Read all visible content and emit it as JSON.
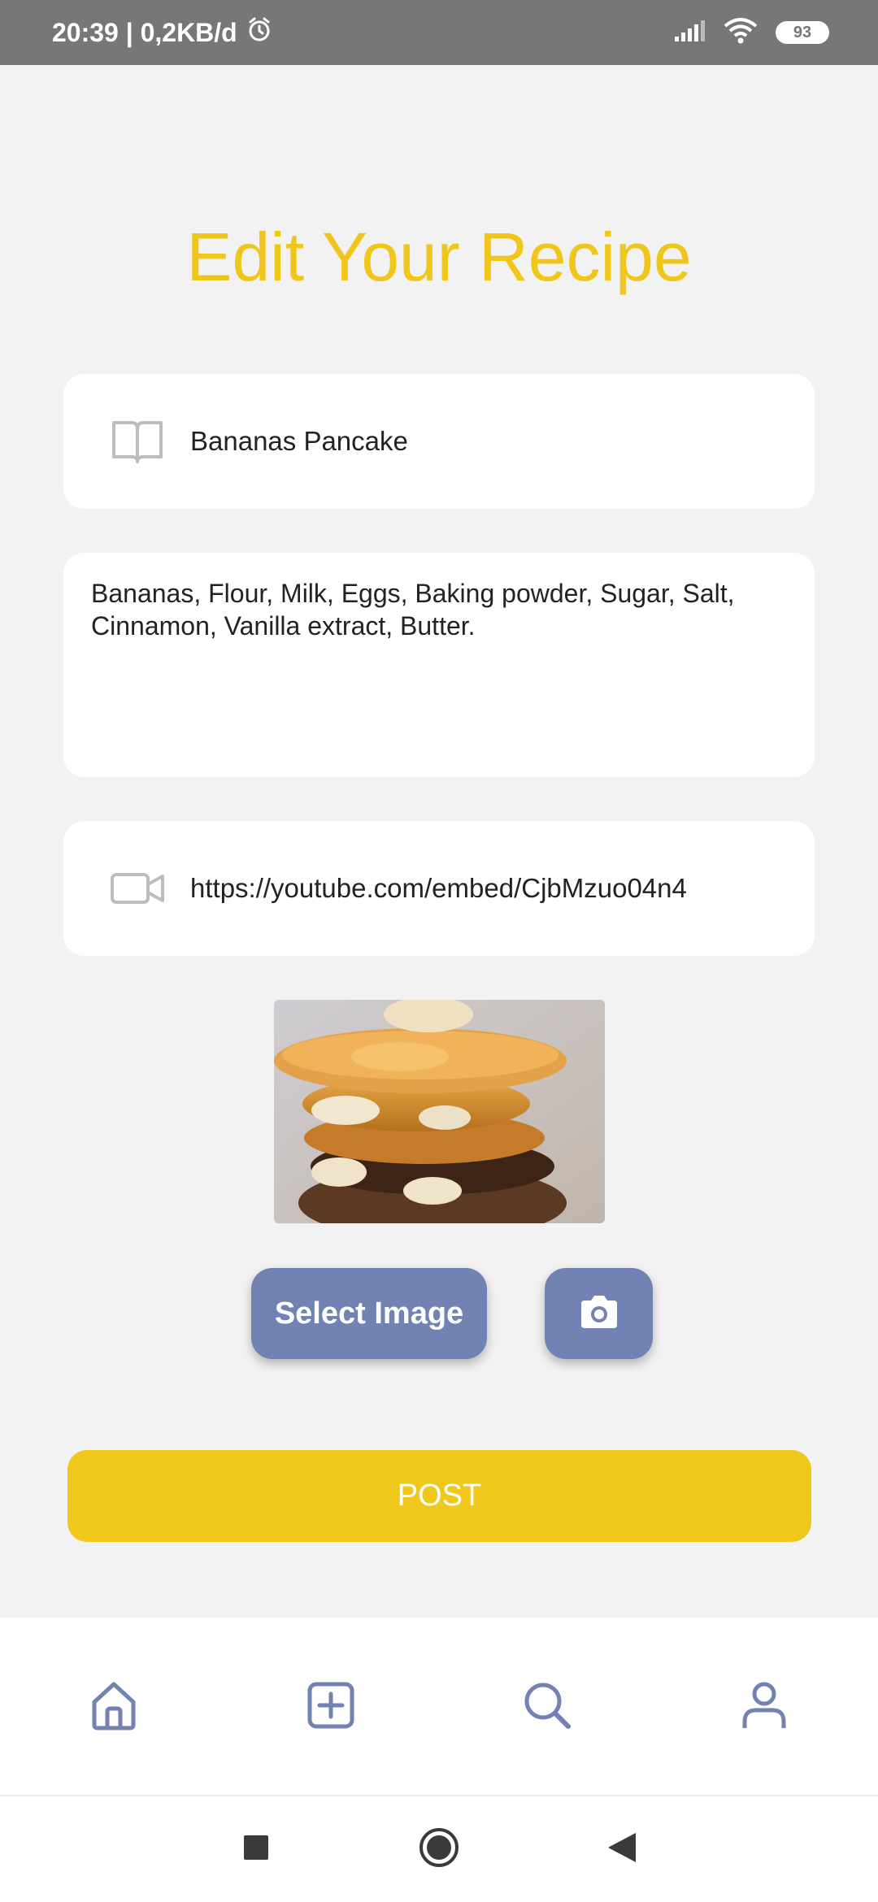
{
  "status_bar": {
    "time_speed": "20:39 | 0,2KB/d",
    "battery": "93"
  },
  "page": {
    "title": "Edit Your Recipe"
  },
  "form": {
    "recipe_name": "Bananas Pancake",
    "ingredients": "Bananas, Flour, Milk, Eggs, Baking powder, Sugar, Salt, Cinnamon, Vanilla extract, Butter.",
    "video_url": "https://youtube.com/embed/CjbMzuo04n4"
  },
  "buttons": {
    "select_image": "Select Image",
    "post": "POST"
  },
  "colors": {
    "accent_yellow": "#f0c61b",
    "button_blue": "#7282b2",
    "status_bar": "#777777",
    "background": "#f2f2f2"
  },
  "icons": {
    "recipe_name": "book-icon",
    "video": "video-camera-icon",
    "camera": "camera-icon",
    "nav": [
      "home-icon",
      "add-square-icon",
      "search-icon",
      "user-icon"
    ],
    "system": [
      "recents-square-icon",
      "home-circle-icon",
      "back-triangle-icon"
    ]
  }
}
